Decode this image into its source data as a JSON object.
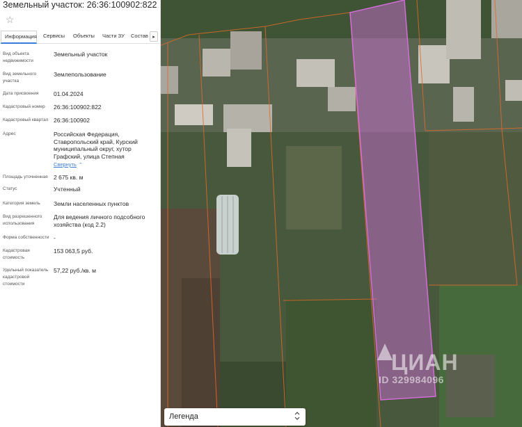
{
  "panel": {
    "title": "Земельный участок: 26:36:100902:822",
    "star_icon": "☆",
    "tabs": [
      {
        "label": "Информация",
        "active": true
      },
      {
        "label": "Сервисы",
        "active": false
      },
      {
        "label": "Объекты",
        "active": false
      },
      {
        "label": "Части ЗУ",
        "active": false
      },
      {
        "label": "Состав",
        "active": false
      }
    ],
    "tabs_next_icon": "▸",
    "fields": [
      {
        "label": "Вид объекта недвижимости",
        "value": "Земельный участок"
      },
      {
        "label": "Вид земельного участка",
        "value": "Землепользование"
      },
      {
        "label": "Дата присвоения",
        "value": "01.04.2024"
      },
      {
        "label": "Кадастровый номер",
        "value": "26:36:100902:822"
      },
      {
        "label": "Кадастровый квартал",
        "value": "26:36:100902"
      },
      {
        "label": "Адрес",
        "value": "Российская Федерация, Ставропольский край, Курский муниципальный округ, хутор Графский, улица Степная"
      },
      {
        "label": "Площадь уточненная",
        "value": "2 675 кв. м"
      },
      {
        "label": "Статус",
        "value": "Учтенный"
      },
      {
        "label": "Категория земель",
        "value": "Земли населенных пунктов"
      },
      {
        "label": "Вид разрешенного использования",
        "value": "Для ведения личного подсобного хозяйства (код 2.2)"
      },
      {
        "label": "Форма собственности",
        "value": "-"
      },
      {
        "label": "Кадастровая стоимость",
        "value": "153 063,5 руб."
      },
      {
        "label": "Удельный показатель кадастровой стоимости",
        "value": "57,22 руб./кв. м"
      }
    ],
    "collapse_link": "Свернуть",
    "collapse_icon": "⌃"
  },
  "map": {
    "legend_label": "Легенда",
    "legend_icon": "⌃⌄",
    "watermark_brand": "ЦИАН",
    "watermark_id": "ID 329984096",
    "highlight_color": "#d86ee0",
    "boundary_color": "#e06a2a"
  }
}
